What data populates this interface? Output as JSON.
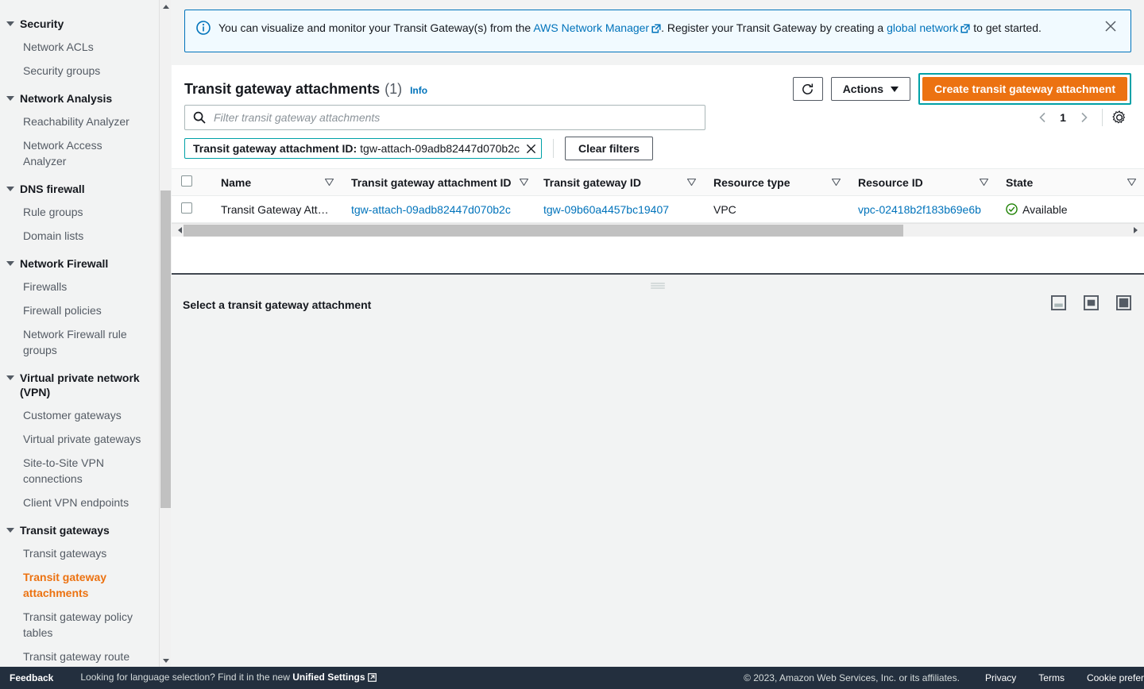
{
  "banner": {
    "icon": "info-circle-icon",
    "text_part1": "You can visualize and monitor your Transit Gateway(s) from the ",
    "link1": "AWS Network Manager",
    "text_part2": ". Register your Transit Gateway by creating a ",
    "link2": "global network",
    "text_part3": " to get started.",
    "close_label": "×"
  },
  "sidebar": {
    "groups": [
      {
        "title": "Security",
        "items": [
          {
            "label": "Network ACLs",
            "active": false
          },
          {
            "label": "Security groups",
            "active": false
          }
        ]
      },
      {
        "title": "Network Analysis",
        "items": [
          {
            "label": "Reachability Analyzer",
            "active": false
          },
          {
            "label": "Network Access Analyzer",
            "active": false
          }
        ]
      },
      {
        "title": "DNS firewall",
        "items": [
          {
            "label": "Rule groups",
            "active": false
          },
          {
            "label": "Domain lists",
            "active": false
          }
        ]
      },
      {
        "title": "Network Firewall",
        "items": [
          {
            "label": "Firewalls",
            "active": false
          },
          {
            "label": "Firewall policies",
            "active": false
          },
          {
            "label": "Network Firewall rule groups",
            "active": false
          }
        ]
      },
      {
        "title": "Virtual private network (VPN)",
        "items": [
          {
            "label": "Customer gateways",
            "active": false
          },
          {
            "label": "Virtual private gateways",
            "active": false
          },
          {
            "label": "Site-to-Site VPN connections",
            "active": false
          },
          {
            "label": "Client VPN endpoints",
            "active": false
          }
        ]
      },
      {
        "title": "Transit gateways",
        "items": [
          {
            "label": "Transit gateways",
            "active": false
          },
          {
            "label": "Transit gateway attachments",
            "active": true
          },
          {
            "label": "Transit gateway policy tables",
            "active": false
          },
          {
            "label": "Transit gateway route tables",
            "active": false
          }
        ]
      }
    ]
  },
  "panel": {
    "title": "Transit gateway attachments",
    "count": "(1)",
    "info_label": "Info",
    "refresh_icon": "refresh-icon",
    "actions_label": "Actions",
    "create_label": "Create transit gateway attachment"
  },
  "search": {
    "placeholder": "Filter transit gateway attachments",
    "value": "",
    "icon": "search-icon"
  },
  "pagination": {
    "prev": "‹",
    "page": "1",
    "next": "›",
    "settings_icon": "gear-icon"
  },
  "filter_token": {
    "key": "Transit gateway attachment ID:",
    "value": "tgw-attach-09adb82447d070b2c",
    "remove_icon": "close-icon",
    "clear_label": "Clear filters"
  },
  "table": {
    "columns": [
      "Name",
      "Transit gateway attachment ID",
      "Transit gateway ID",
      "Resource type",
      "Resource ID",
      "State"
    ],
    "rows": [
      {
        "name": "Transit Gateway Att…",
        "attachment_id": "tgw-attach-09adb82447d070b2c",
        "transit_gateway_id": "tgw-09b60a4457bc19407",
        "resource_type": "VPC",
        "resource_id": "vpc-02418b2f183b69e6b",
        "state": "Available",
        "state_icon": "check-circle-icon"
      }
    ]
  },
  "split_panel": {
    "title": "Select a transit gateway attachment",
    "layout_icons": [
      "layout-bottom-icon",
      "layout-center-icon",
      "layout-side-icon"
    ]
  },
  "footer": {
    "feedback": "Feedback",
    "language_prefix": "Looking for language selection? Find it in the new ",
    "language_link": "Unified Settings",
    "copyright": "© 2023, Amazon Web Services, Inc. or its affiliates.",
    "privacy": "Privacy",
    "terms": "Terms",
    "cookies": "Cookie prefer"
  },
  "colors": {
    "accent_orange": "#ec7211",
    "link_blue": "#0073bb",
    "focus_teal": "#00a1a7",
    "state_green": "#1d8102",
    "footer_dark": "#232f3e"
  }
}
